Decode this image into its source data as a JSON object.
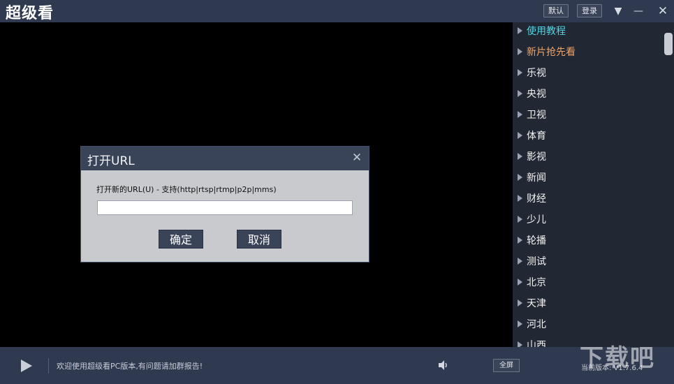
{
  "app": {
    "title": "超级看",
    "buttons": {
      "default_label": "默认",
      "login_label": "登录"
    },
    "icons": {
      "menu": "▼",
      "minimize": "—",
      "close": "✕"
    }
  },
  "sidebar": {
    "items": [
      {
        "label": "使用教程",
        "color": "#4fd6e6"
      },
      {
        "label": "新片抢先看",
        "color": "#f0a46a"
      },
      {
        "label": "乐视"
      },
      {
        "label": "央视"
      },
      {
        "label": "卫视"
      },
      {
        "label": "体育"
      },
      {
        "label": "影视"
      },
      {
        "label": "新闻"
      },
      {
        "label": "财经"
      },
      {
        "label": "少儿"
      },
      {
        "label": "轮播"
      },
      {
        "label": "测试"
      },
      {
        "label": "北京"
      },
      {
        "label": "天津"
      },
      {
        "label": "河北"
      },
      {
        "label": "山西"
      }
    ]
  },
  "dialog": {
    "title": "打开URL",
    "close_icon": "✕",
    "prompt": "打开新的URL(U) - 支持(http|rtsp|rtmp|p2p|mms)",
    "url_value": "",
    "ok_label": "确定",
    "cancel_label": "取消"
  },
  "bottom": {
    "marquee": "欢迎使用超级看PC版本,有问题请加群报告!",
    "fullscreen_label": "全屏",
    "version": "当前版本: V1.7.6.4",
    "watermark": "下载吧"
  }
}
